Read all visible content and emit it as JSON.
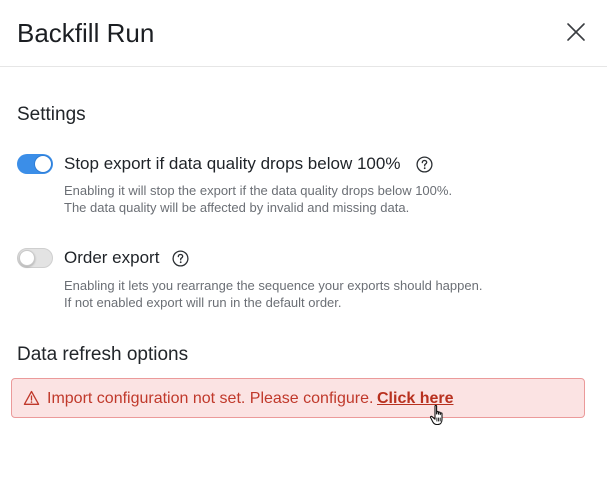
{
  "header": {
    "title": "Backfill Run",
    "close_icon": "close-icon"
  },
  "settings": {
    "title": "Settings",
    "options": [
      {
        "label": "Stop export if data quality drops below 100%",
        "enabled": true,
        "help_icon": "help-icon",
        "description": [
          "Enabling it will stop the export if the data quality drops below 100%.",
          "The data quality will be affected by invalid and missing data."
        ]
      },
      {
        "label": "Order export",
        "enabled": false,
        "help_icon": "help-icon",
        "description": [
          "Enabling it lets you rearrange the sequence your exports should happen.",
          "If not enabled export will run in the default order."
        ]
      }
    ]
  },
  "data_refresh": {
    "title": "Data refresh options",
    "alert": {
      "icon": "warning-icon",
      "message": "Import configuration not set. Please configure.",
      "link": "Click here"
    }
  },
  "colors": {
    "toggle_on": "#3b8ee8",
    "alert_bg": "#fbe3e3",
    "alert_border": "#eb9a9a",
    "alert_text": "#c0392b"
  }
}
